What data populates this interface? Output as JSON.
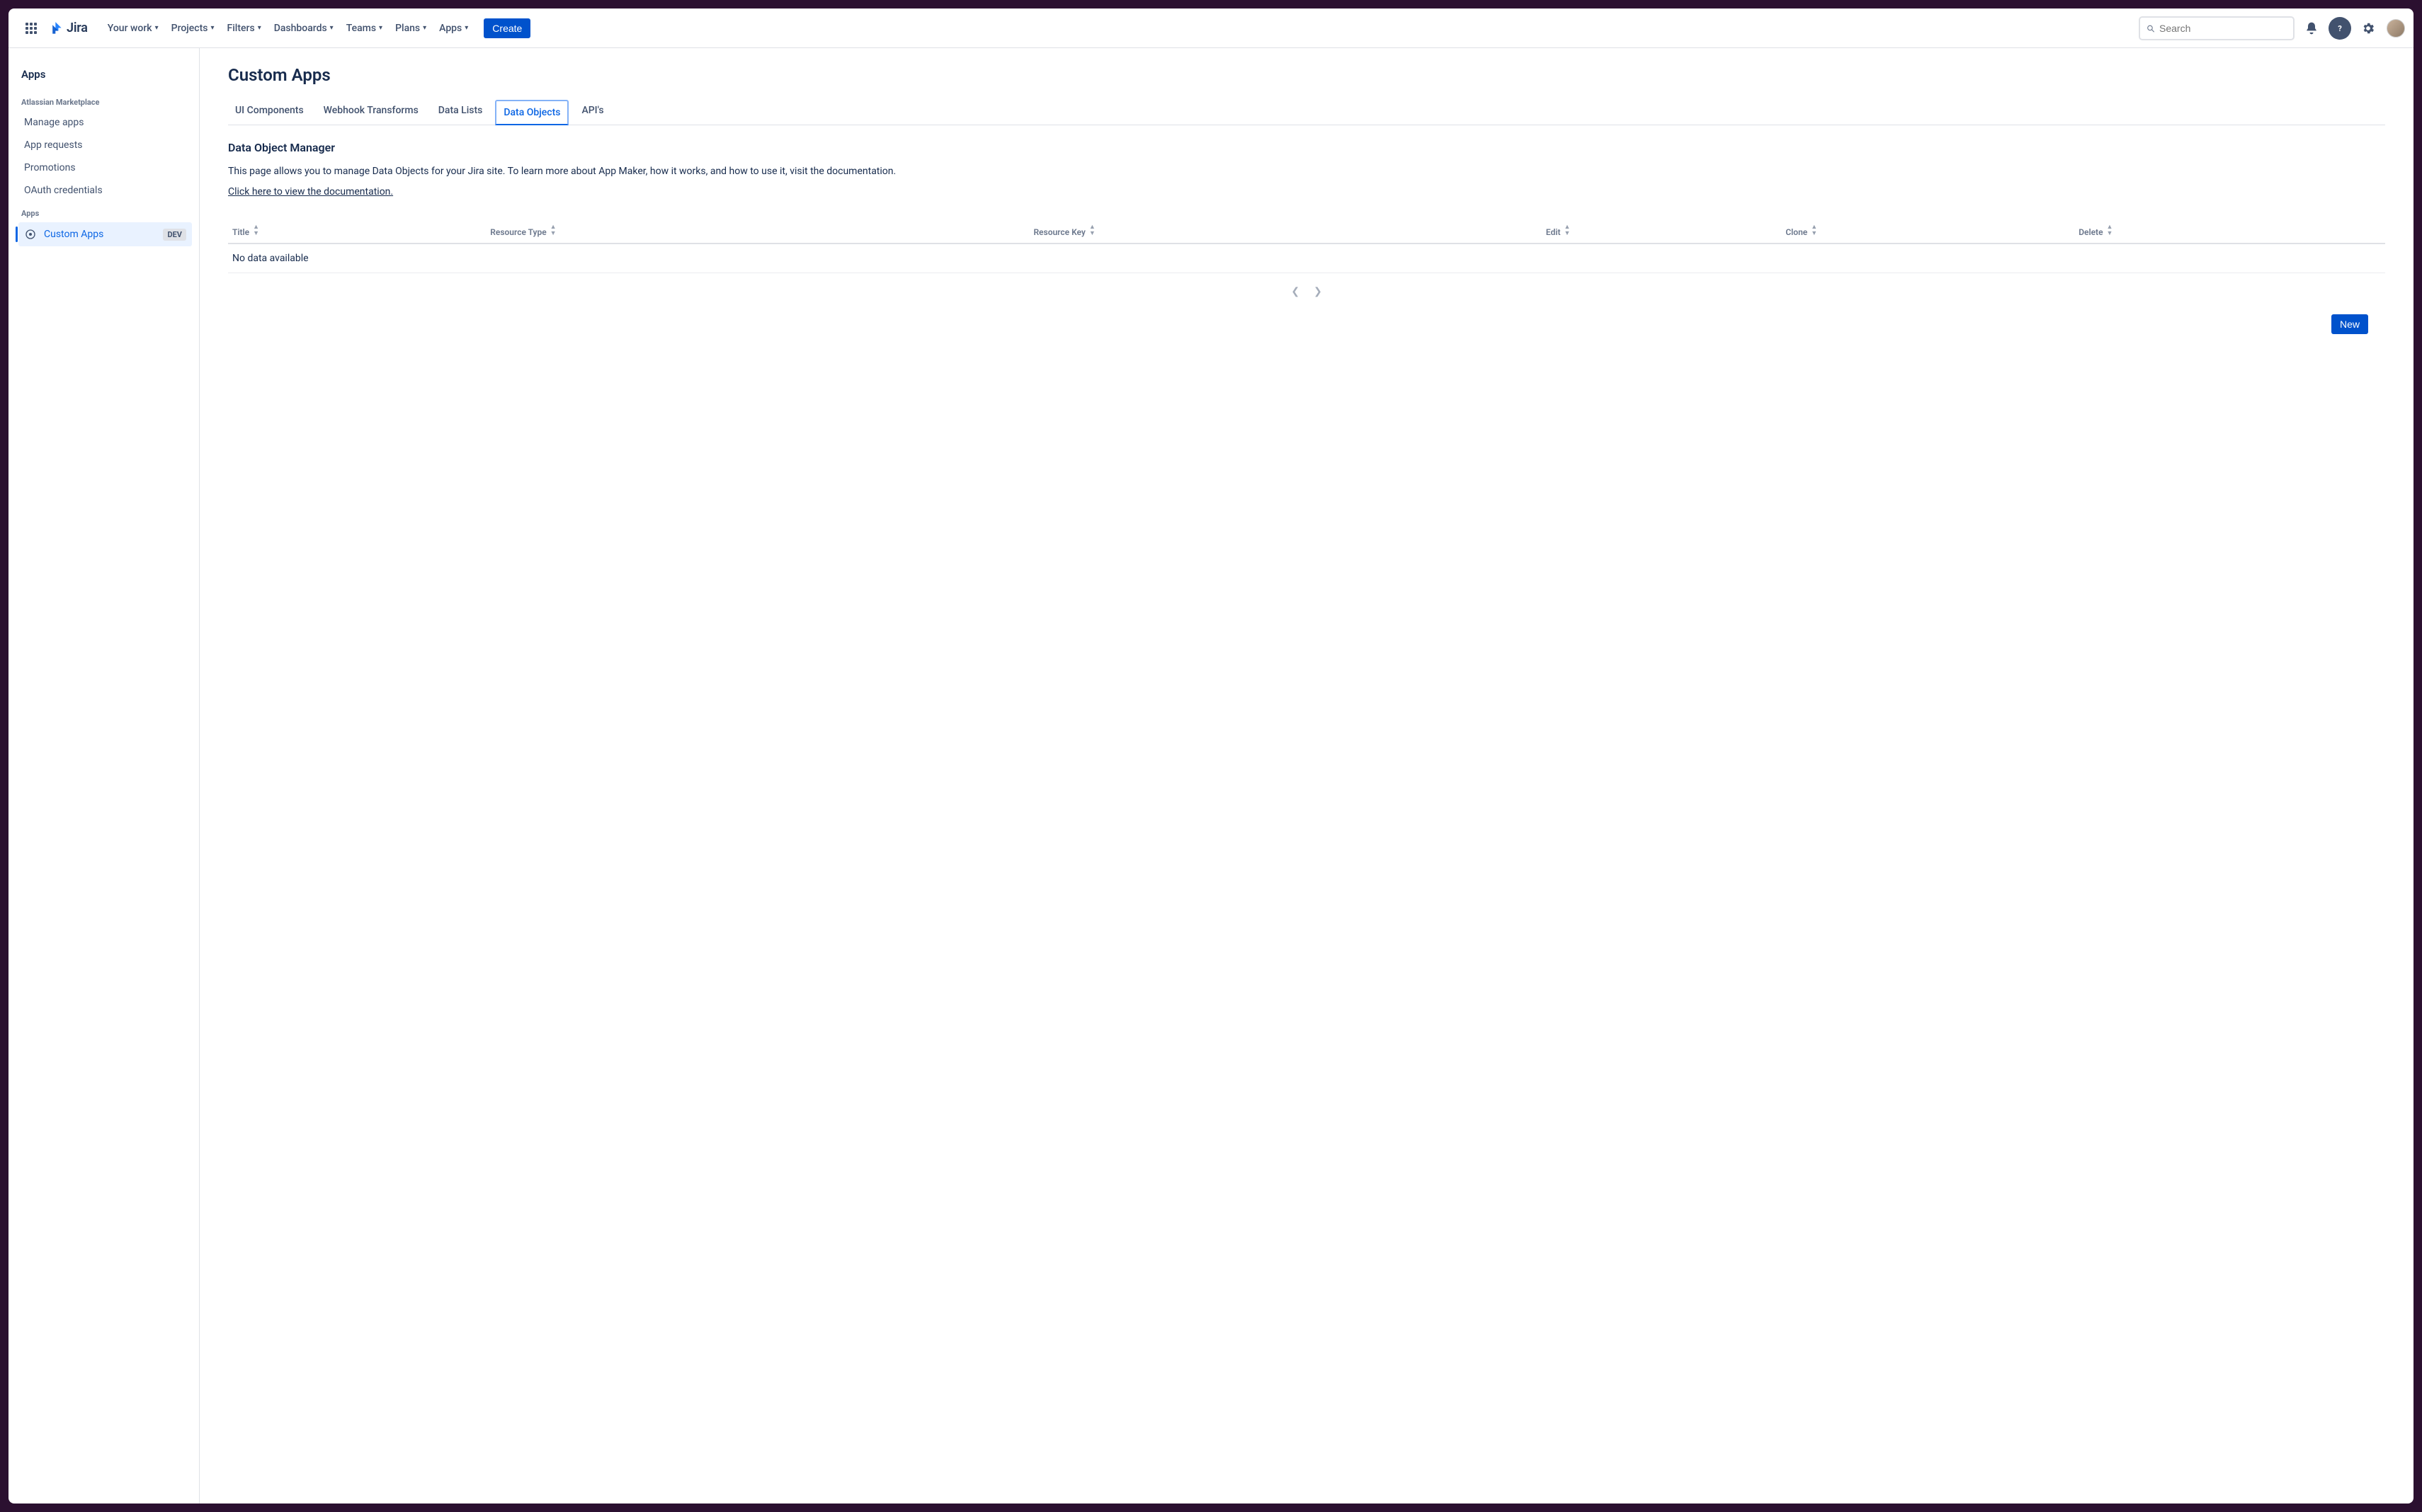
{
  "topnav": {
    "product": "Jira",
    "items": [
      "Your work",
      "Projects",
      "Filters",
      "Dashboards",
      "Teams",
      "Plans",
      "Apps"
    ],
    "create_label": "Create",
    "search_placeholder": "Search"
  },
  "sidebar": {
    "title": "Apps",
    "sections": [
      {
        "label": "Atlassian Marketplace",
        "items": [
          {
            "label": "Manage apps"
          },
          {
            "label": "App requests"
          },
          {
            "label": "Promotions"
          },
          {
            "label": "OAuth credentials"
          }
        ]
      },
      {
        "label": "Apps",
        "items": [
          {
            "label": "Custom Apps",
            "badge": "DEV",
            "active": true,
            "icon": "app"
          }
        ]
      }
    ]
  },
  "page": {
    "title": "Custom Apps",
    "tabs": [
      "UI Components",
      "Webhook Transforms",
      "Data Lists",
      "Data Objects",
      "API's"
    ],
    "active_tab": "Data Objects",
    "section_title": "Data Object Manager",
    "description": "This page allows you to manage Data Objects for your Jira site. To learn more about App Maker, how it works, and how to use it, visit the documentation.",
    "doc_link": "Click here to view the documentation.",
    "table": {
      "columns": [
        "Title",
        "Resource Type",
        "Resource Key",
        "Edit",
        "Clone",
        "Delete"
      ],
      "empty_message": "No data available"
    },
    "new_label": "New"
  }
}
